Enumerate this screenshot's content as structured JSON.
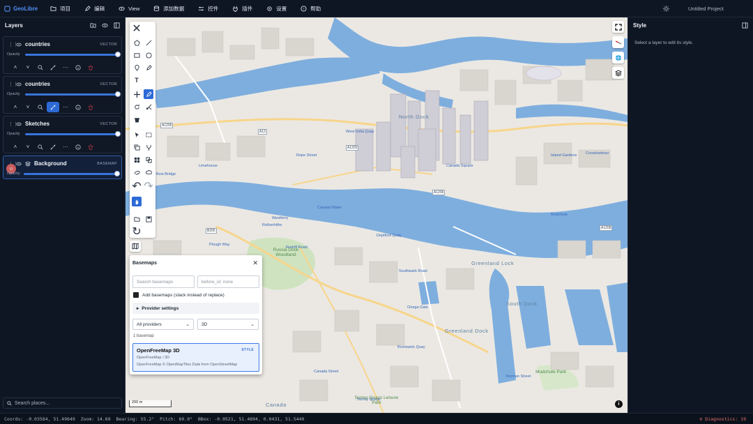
{
  "app": {
    "name": "GeoLibre",
    "project": "Untitled Project"
  },
  "menu": [
    {
      "label": "项目",
      "icon": "folder-icon"
    },
    {
      "label": "编辑",
      "icon": "pencil-icon"
    },
    {
      "label": "View",
      "icon": "eye-icon"
    },
    {
      "label": "添加数据",
      "icon": "database-icon"
    },
    {
      "label": "控件",
      "icon": "sliders-icon"
    },
    {
      "label": "插件",
      "icon": "plug-icon"
    },
    {
      "label": "设置",
      "icon": "gear-icon"
    },
    {
      "label": "帮助",
      "icon": "help-icon"
    }
  ],
  "layers_panel": {
    "title": "Layers",
    "opacity_label": "Opacity",
    "layers": [
      {
        "name": "countries",
        "type": "VECTOR",
        "opacity": 1.0
      },
      {
        "name": "countries",
        "type": "VECTOR",
        "opacity": 1.0
      },
      {
        "name": "Sketches",
        "type": "VECTOR",
        "opacity": 1.0
      },
      {
        "name": "Background",
        "type": "BASEMAP",
        "opacity": 1.0
      }
    ],
    "search_placeholder": "Search places..."
  },
  "style_panel": {
    "title": "Style",
    "hint": "Select a layer to edit its style."
  },
  "basemaps": {
    "title": "Basemaps",
    "search_placeholder": "Search basemaps",
    "before_id_placeholder": "before_id: none",
    "add_label": "Add basemaps (stack instead of replace)",
    "add_checked": true,
    "provider_settings": "Provider settings",
    "provider_filter": "All providers",
    "mode_filter": "3D",
    "count": "1 basemap",
    "items": [
      {
        "name": "OpenFreeMap 3D",
        "badge": "STYLE",
        "path": "OpenFreeMap / 3D",
        "attribution": "OpenFreeMap © OpenMapTiles Data from OpenStreetMap"
      }
    ]
  },
  "map": {
    "scale": "200 m",
    "places": [
      "North Dock",
      "Greenland Lock",
      "South Dock",
      "Greenland Dock",
      "Canada"
    ],
    "roads": [
      "A1203",
      "A1205",
      "A13",
      "A1206",
      "B205",
      "A1208"
    ],
    "stations": [
      "Limehouse",
      "Westferry",
      "Bow Bridge",
      "West India Quay",
      "Canada Water",
      "Rotherhithe",
      "Surrey Quays",
      "Canada Street",
      "Deptford Quay",
      "Island Gardens",
      "Brunswick Quay",
      "Crossharbour",
      "Mudchute",
      "Yeoman Street",
      "Onega Gate",
      "Southwark Road",
      "Rope Street",
      "Canada Square",
      "Redriff Road",
      "Plough Way"
    ],
    "parks": [
      "Surrey Quays Leisure Park",
      "Russia Dock Woodland",
      "Mudchute Park"
    ]
  },
  "status_bar": {
    "coords": "Coords: -0.03584, 51.49649",
    "zoom": "Zoom: 14.69",
    "bearing": "Bearing: 55.2°",
    "pitch": "Pitch: 60.0°",
    "bbox": "BBox: -0.0521, 51.4894, 0.0431, 51.5440",
    "diagnostics": "Diagnostics: 19"
  },
  "colors": {
    "accent": "#2d6ad6",
    "water": "#7eaede",
    "land": "#ebe8e3",
    "panel": "#0f1623"
  }
}
